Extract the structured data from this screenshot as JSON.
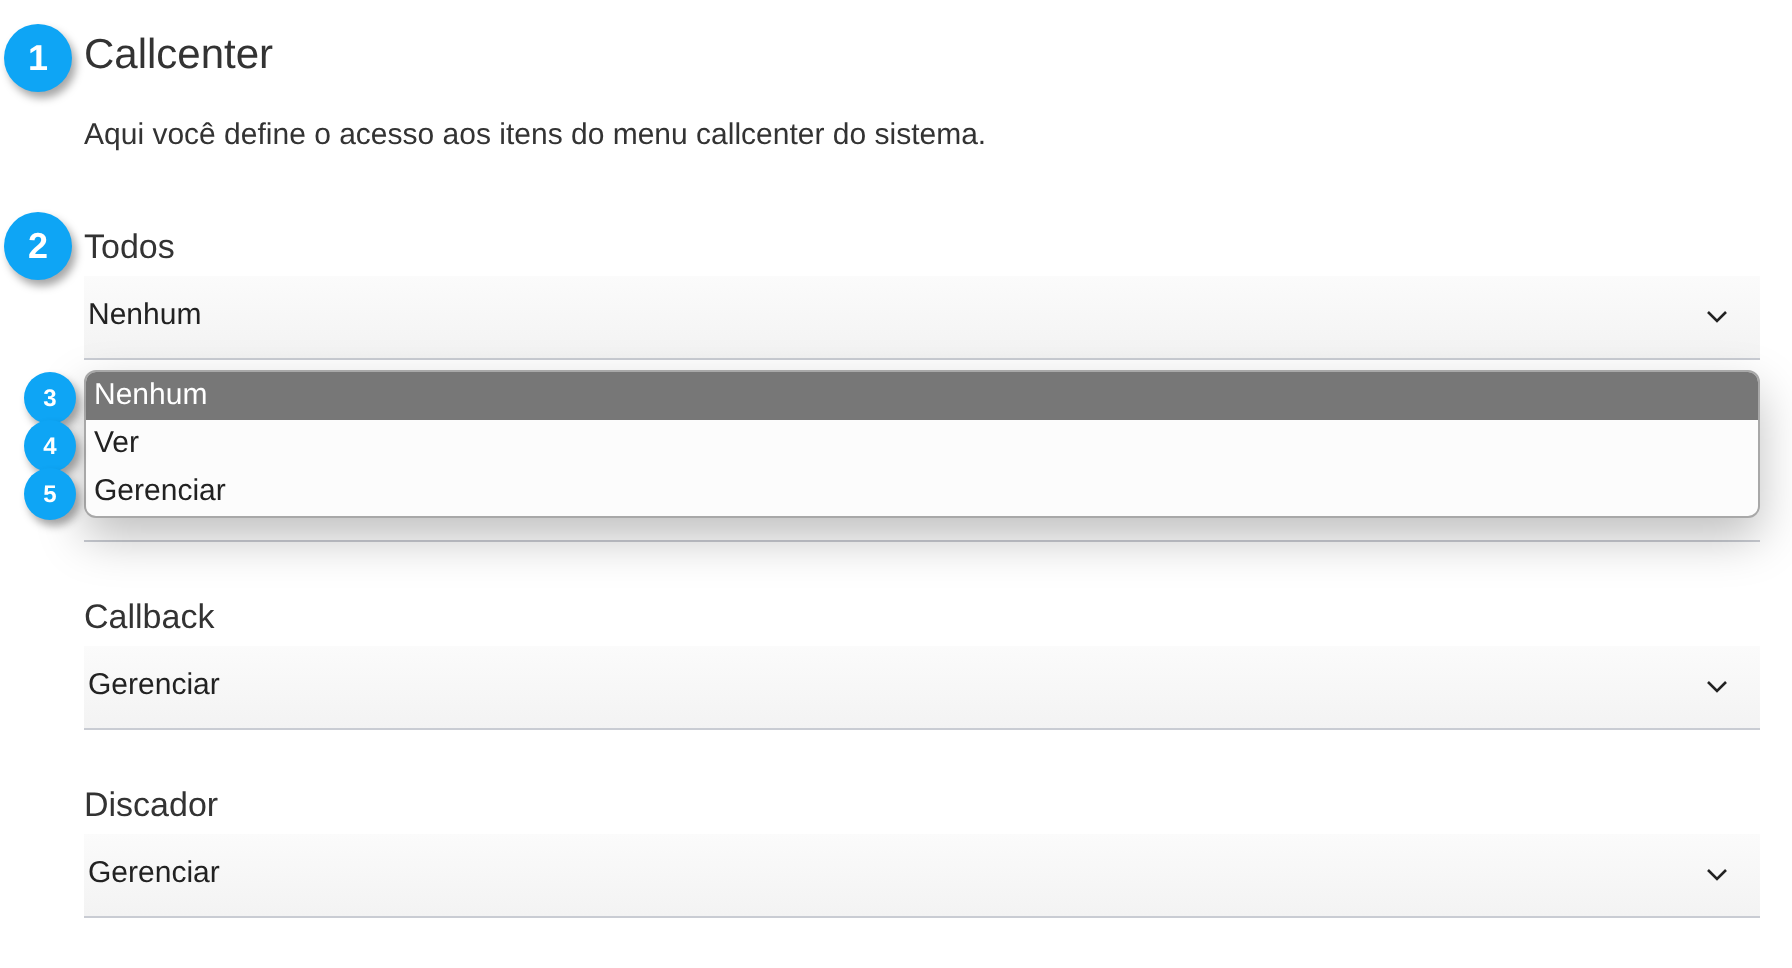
{
  "header": {
    "marker": "1",
    "title": "Callcenter",
    "description": "Aqui você define o acesso aos itens do menu callcenter do sistema."
  },
  "fields": [
    {
      "marker": "2",
      "label": "Todos",
      "value": "Nenhum",
      "options": [
        {
          "label": "Nenhum",
          "selected": true,
          "marker": "3"
        },
        {
          "label": "Ver",
          "selected": false,
          "marker": "4"
        },
        {
          "label": "Gerenciar",
          "selected": false,
          "marker": "5"
        }
      ]
    },
    {
      "kind": "hidden"
    },
    {
      "label": "Callback",
      "value": "Gerenciar"
    },
    {
      "label": "Discador",
      "value": "Gerenciar"
    }
  ]
}
